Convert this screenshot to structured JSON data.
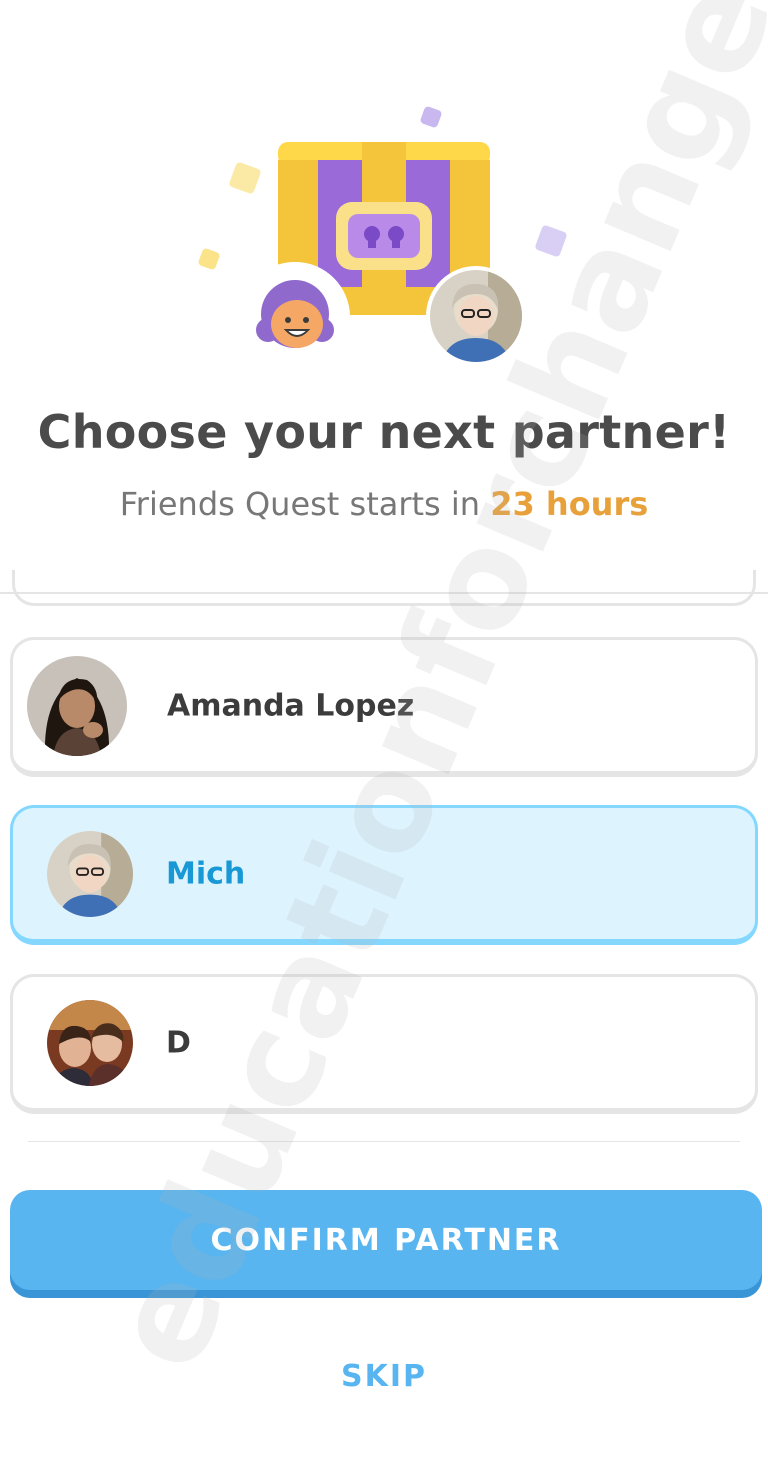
{
  "header": {
    "title": "Choose your next partner!",
    "subtitle_prefix": "Friends Quest starts in ",
    "subtitle_highlight": "23 hours"
  },
  "hero": {
    "chest_icon": "treasure-chest-icon",
    "user_avatar_icon": "user-avatar-icon",
    "partner_photo_icon": "partner-photo-icon"
  },
  "partners": [
    {
      "name": "Amanda Lopez",
      "selected": false,
      "photo_icon": "amanda-photo-icon"
    },
    {
      "name": "Mich",
      "selected": true,
      "photo_icon": "mich-photo-icon"
    },
    {
      "name": "D",
      "selected": false,
      "photo_icon": "d-photo-icon"
    }
  ],
  "actions": {
    "confirm_label": "CONFIRM PARTNER",
    "skip_label": "SKIP"
  },
  "watermark": "educationforchanges.com",
  "colors": {
    "primary": "#58b5f0",
    "highlight": "#e8a13a",
    "selected_bg": "#ddf4ff",
    "selected_border": "#84d8ff",
    "selected_text": "#1899d6"
  }
}
